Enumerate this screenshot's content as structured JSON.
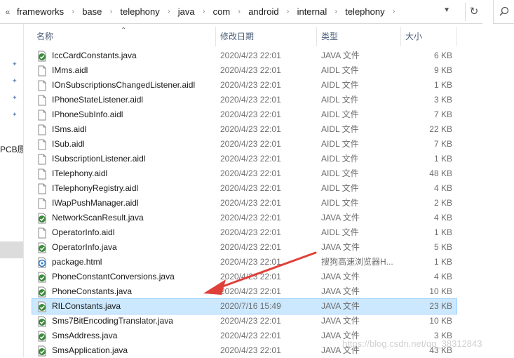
{
  "address": {
    "back_glyph": "«",
    "crumbs": [
      "frameworks",
      "base",
      "telephony",
      "java",
      "com",
      "android",
      "internal",
      "telephony"
    ]
  },
  "nav": {
    "pcb_label": "PCB原"
  },
  "columns": {
    "name": "名称",
    "date": "修改日期",
    "type": "类型",
    "size": "大小"
  },
  "colors": {
    "selected_bg": "#cce8ff",
    "arrow": "#e0403a"
  },
  "files": [
    {
      "name": "IccCardConstants.java",
      "date": "2020/4/23 22:01",
      "type": "JAVA 文件",
      "size": "6 KB",
      "icon": "java-file-icon"
    },
    {
      "name": "IMms.aidl",
      "date": "2020/4/23 22:01",
      "type": "AIDL 文件",
      "size": "9 KB",
      "icon": "aidl-file-icon"
    },
    {
      "name": "IOnSubscriptionsChangedListener.aidl",
      "date": "2020/4/23 22:01",
      "type": "AIDL 文件",
      "size": "1 KB",
      "icon": "aidl-file-icon"
    },
    {
      "name": "IPhoneStateListener.aidl",
      "date": "2020/4/23 22:01",
      "type": "AIDL 文件",
      "size": "3 KB",
      "icon": "aidl-file-icon"
    },
    {
      "name": "IPhoneSubInfo.aidl",
      "date": "2020/4/23 22:01",
      "type": "AIDL 文件",
      "size": "7 KB",
      "icon": "aidl-file-icon"
    },
    {
      "name": "ISms.aidl",
      "date": "2020/4/23 22:01",
      "type": "AIDL 文件",
      "size": "22 KB",
      "icon": "aidl-file-icon"
    },
    {
      "name": "ISub.aidl",
      "date": "2020/4/23 22:01",
      "type": "AIDL 文件",
      "size": "7 KB",
      "icon": "aidl-file-icon"
    },
    {
      "name": "ISubscriptionListener.aidl",
      "date": "2020/4/23 22:01",
      "type": "AIDL 文件",
      "size": "1 KB",
      "icon": "aidl-file-icon"
    },
    {
      "name": "ITelephony.aidl",
      "date": "2020/4/23 22:01",
      "type": "AIDL 文件",
      "size": "48 KB",
      "icon": "aidl-file-icon"
    },
    {
      "name": "ITelephonyRegistry.aidl",
      "date": "2020/4/23 22:01",
      "type": "AIDL 文件",
      "size": "4 KB",
      "icon": "aidl-file-icon"
    },
    {
      "name": "IWapPushManager.aidl",
      "date": "2020/4/23 22:01",
      "type": "AIDL 文件",
      "size": "2 KB",
      "icon": "aidl-file-icon"
    },
    {
      "name": "NetworkScanResult.java",
      "date": "2020/4/23 22:01",
      "type": "JAVA 文件",
      "size": "4 KB",
      "icon": "java-file-icon"
    },
    {
      "name": "OperatorInfo.aidl",
      "date": "2020/4/23 22:01",
      "type": "AIDL 文件",
      "size": "1 KB",
      "icon": "aidl-file-icon"
    },
    {
      "name": "OperatorInfo.java",
      "date": "2020/4/23 22:01",
      "type": "JAVA 文件",
      "size": "5 KB",
      "icon": "java-file-icon"
    },
    {
      "name": "package.html",
      "date": "2020/4/23 22:01",
      "type": "搜狗高速浏览器H...",
      "size": "1 KB",
      "icon": "html-file-icon"
    },
    {
      "name": "PhoneConstantConversions.java",
      "date": "2020/4/23 22:01",
      "type": "JAVA 文件",
      "size": "4 KB",
      "icon": "java-file-icon"
    },
    {
      "name": "PhoneConstants.java",
      "date": "2020/4/23 22:01",
      "type": "JAVA 文件",
      "size": "10 KB",
      "icon": "java-file-icon"
    },
    {
      "name": "RILConstants.java",
      "date": "2020/7/16 15:49",
      "type": "JAVA 文件",
      "size": "23 KB",
      "icon": "java-file-icon",
      "selected": true
    },
    {
      "name": "Sms7BitEncodingTranslator.java",
      "date": "2020/4/23 22:01",
      "type": "JAVA 文件",
      "size": "10 KB",
      "icon": "java-file-icon"
    },
    {
      "name": "SmsAddress.java",
      "date": "2020/4/23 22:01",
      "type": "JAVA 文件",
      "size": "3 KB",
      "icon": "java-file-icon"
    },
    {
      "name": "SmsApplication.java",
      "date": "2020/4/23 22:01",
      "type": "JAVA 文件",
      "size": "43 KB",
      "icon": "java-file-icon"
    }
  ],
  "watermark": "https://blog.csdn.net/qq_38312843"
}
